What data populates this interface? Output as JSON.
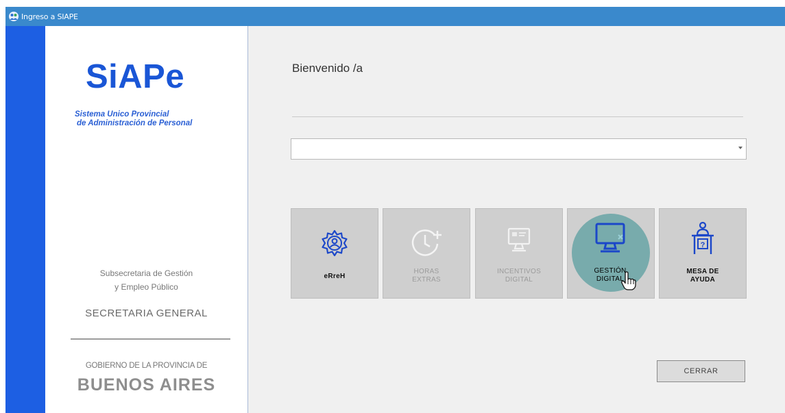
{
  "window": {
    "title": "Ingreso a SIAPE"
  },
  "left_panel": {
    "logo": "SiAPe",
    "logo_subtitle_line1": "Sistema Unico Provincial",
    "logo_subtitle_line2": "de Administración de Personal",
    "subsecretaria_line1": "Subsecretaria de Gestión",
    "subsecretaria_line2": "y Empleo Público",
    "secretaria": "SECRETARIA GENERAL",
    "gobierno": "GOBIERNO DE LA PROVINCIA DE",
    "provincia": "BUENOS AIRES"
  },
  "main": {
    "welcome": "Bienvenido /a",
    "combo_value": ""
  },
  "tiles": [
    {
      "line1": "eRreH",
      "line2": "",
      "icon": "gear-user-icon",
      "enabled": true
    },
    {
      "line1": "HORAS",
      "line2": "EXTRAS",
      "icon": "clock-plus-icon",
      "enabled": false
    },
    {
      "line1": "INCENTIVOS",
      "line2": "DIGITAL",
      "icon": "monitor-icon",
      "enabled": false
    },
    {
      "line1": "GESTIÓN",
      "line2": "DIGITAL",
      "icon": "computer-icon",
      "enabled": true
    },
    {
      "line1": "MESA DE",
      "line2": "AYUDA",
      "icon": "help-desk-icon",
      "enabled": true
    }
  ],
  "buttons": {
    "close": "CERRAR"
  },
  "colors": {
    "titlebar": "#3a89cc",
    "side_strip": "#1d5fe3",
    "logo": "#1a56d6",
    "highlight": "#78abac",
    "icon_blue": "#1b47c9"
  }
}
